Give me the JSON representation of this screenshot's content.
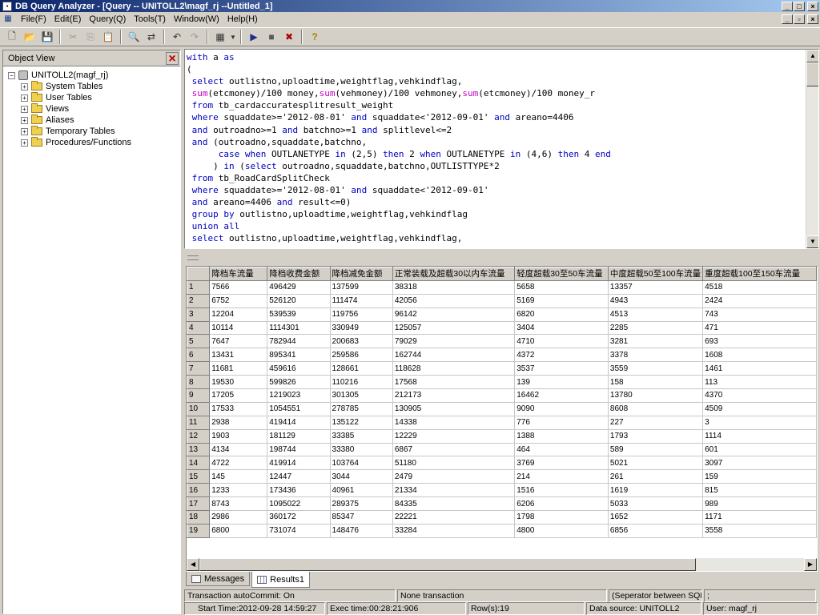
{
  "window": {
    "title": "DB Query Analyzer - [Query -- UNITOLL2\\magf_rj --Untitled_1]"
  },
  "menu": [
    "File(F)",
    "Edit(E)",
    "Query(Q)",
    "Tools(T)",
    "Window(W)",
    "Help(H)"
  ],
  "object_view": {
    "title": "Object View",
    "root": "UNITOLL2(magf_rj)",
    "children": [
      "System Tables",
      "User Tables",
      "Views",
      "Aliases",
      "Temporary Tables",
      "Procedures/Functions"
    ]
  },
  "editor": {
    "lines": [
      [
        [
          "kw",
          "with"
        ],
        [
          "t",
          " a "
        ],
        [
          "kw",
          "as"
        ]
      ],
      [
        [
          "t",
          "("
        ]
      ],
      [
        [
          "t",
          " "
        ],
        [
          "kw",
          "select"
        ],
        [
          "t",
          " outlistno,uploadtime,weightflag,vehkindflag,"
        ]
      ],
      [
        [
          "t",
          " "
        ],
        [
          "fn",
          "sum"
        ],
        [
          "t",
          "(etcmoney)/100 money,"
        ],
        [
          "fn",
          "sum"
        ],
        [
          "t",
          "(vehmoney)/100 vehmoney,"
        ],
        [
          "fn",
          "sum"
        ],
        [
          "t",
          "(etcmoney)/100 money_r"
        ]
      ],
      [
        [
          "t",
          " "
        ],
        [
          "kw",
          "from"
        ],
        [
          "t",
          " tb_cardaccuratesplitresult_weight"
        ]
      ],
      [
        [
          "t",
          " "
        ],
        [
          "kw",
          "where"
        ],
        [
          "t",
          " squaddate>='2012-08-01' "
        ],
        [
          "kw",
          "and"
        ],
        [
          "t",
          " squaddate<'2012-09-01' "
        ],
        [
          "kw",
          "and"
        ],
        [
          "t",
          " areano=4406"
        ]
      ],
      [
        [
          "t",
          " "
        ],
        [
          "kw",
          "and"
        ],
        [
          "t",
          " outroadno>=1 "
        ],
        [
          "kw",
          "and"
        ],
        [
          "t",
          " batchno>=1 "
        ],
        [
          "kw",
          "and"
        ],
        [
          "t",
          " splitlevel<=2"
        ]
      ],
      [
        [
          "t",
          " "
        ],
        [
          "kw",
          "and"
        ],
        [
          "t",
          " (outroadno,squaddate,batchno,"
        ]
      ],
      [
        [
          "t",
          "      "
        ],
        [
          "kw",
          "case when"
        ],
        [
          "t",
          " OUTLANETYPE "
        ],
        [
          "kw",
          "in"
        ],
        [
          "t",
          " (2,5) "
        ],
        [
          "kw",
          "then"
        ],
        [
          "t",
          " 2 "
        ],
        [
          "kw",
          "when"
        ],
        [
          "t",
          " OUTLANETYPE "
        ],
        [
          "kw",
          "in"
        ],
        [
          "t",
          " (4,6) "
        ],
        [
          "kw",
          "then"
        ],
        [
          "t",
          " 4 "
        ],
        [
          "kw",
          "end"
        ]
      ],
      [
        [
          "t",
          "     ) "
        ],
        [
          "kw",
          "in"
        ],
        [
          "t",
          " ("
        ],
        [
          "kw",
          "select"
        ],
        [
          "t",
          " outroadno,squaddate,batchno,OUTLISTTYPE*2"
        ]
      ],
      [
        [
          "t",
          " "
        ],
        [
          "kw",
          "from"
        ],
        [
          "t",
          " tb_RoadCardSplitCheck"
        ]
      ],
      [
        [
          "t",
          " "
        ],
        [
          "kw",
          "where"
        ],
        [
          "t",
          " squaddate>='2012-08-01' "
        ],
        [
          "kw",
          "and"
        ],
        [
          "t",
          " squaddate<'2012-09-01'"
        ]
      ],
      [
        [
          "t",
          " "
        ],
        [
          "kw",
          "and"
        ],
        [
          "t",
          " areano=4406 "
        ],
        [
          "kw",
          "and"
        ],
        [
          "t",
          " result<=0)"
        ]
      ],
      [
        [
          "t",
          " "
        ],
        [
          "kw",
          "group by"
        ],
        [
          "t",
          " outlistno,uploadtime,weightflag,vehkindflag"
        ]
      ],
      [
        [
          "t",
          " "
        ],
        [
          "kw",
          "union all"
        ]
      ],
      [
        [
          "t",
          " "
        ],
        [
          "kw",
          "select"
        ],
        [
          "t",
          " outlistno,uploadtime,weightflag,vehkindflag,"
        ]
      ]
    ]
  },
  "results": {
    "columns": [
      "降档车流量",
      "降档收费金额",
      "降档减免金额",
      "正常装载及超载30以内车流量",
      "轻度超载30至50车流量",
      "中度超载50至100车流量",
      "重度超载100至150车流量"
    ],
    "rows": [
      [
        "7566",
        "496429",
        "137599",
        "38318",
        "5658",
        "13357",
        "4518"
      ],
      [
        "6752",
        "526120",
        "111474",
        "42056",
        "5169",
        "4943",
        "2424"
      ],
      [
        "12204",
        "539539",
        "119756",
        "96142",
        "6820",
        "4513",
        "743"
      ],
      [
        "10114",
        "1114301",
        "330949",
        "125057",
        "3404",
        "2285",
        "471"
      ],
      [
        "7647",
        "782944",
        "200683",
        "79029",
        "4710",
        "3281",
        "693"
      ],
      [
        "13431",
        "895341",
        "259586",
        "162744",
        "4372",
        "3378",
        "1608"
      ],
      [
        "11681",
        "459616",
        "128661",
        "118628",
        "3537",
        "3559",
        "1461"
      ],
      [
        "19530",
        "599826",
        "110216",
        "17568",
        "139",
        "158",
        "113"
      ],
      [
        "17205",
        "1219023",
        "301305",
        "212173",
        "16462",
        "13780",
        "4370"
      ],
      [
        "17533",
        "1054551",
        "278785",
        "130905",
        "9090",
        "8608",
        "4509"
      ],
      [
        "2938",
        "419414",
        "135122",
        "14338",
        "776",
        "227",
        "3"
      ],
      [
        "1903",
        "181129",
        "33385",
        "12229",
        "1388",
        "1793",
        "1114"
      ],
      [
        "4134",
        "198744",
        "33380",
        "6867",
        "464",
        "589",
        "601"
      ],
      [
        "4722",
        "419914",
        "103764",
        "51180",
        "3769",
        "5021",
        "3097"
      ],
      [
        "145",
        "12447",
        "3044",
        "2479",
        "214",
        "261",
        "159"
      ],
      [
        "1233",
        "173436",
        "40961",
        "21334",
        "1516",
        "1619",
        "815"
      ],
      [
        "8743",
        "1095022",
        "289375",
        "84335",
        "6206",
        "5033",
        "989"
      ],
      [
        "2986",
        "360172",
        "85347",
        "22221",
        "1798",
        "1652",
        "1171"
      ],
      [
        "6800",
        "731074",
        "148476",
        "33284",
        "4800",
        "6856",
        "3558"
      ]
    ]
  },
  "tabs": {
    "messages": "Messages",
    "results": "Results1"
  },
  "status": {
    "autocommit": "Transaction autoCommit: On",
    "transaction": "None transaction",
    "separator": "(Seperator between SQL)",
    "separator_char": ";",
    "start_time": "Start Time:2012-09-28 14:59:27",
    "exec_time": "Exec time:00:28:21:906",
    "rows": "Row(s):19",
    "datasource": "Data source: UNITOLL2",
    "user": "User: magf_rj"
  }
}
